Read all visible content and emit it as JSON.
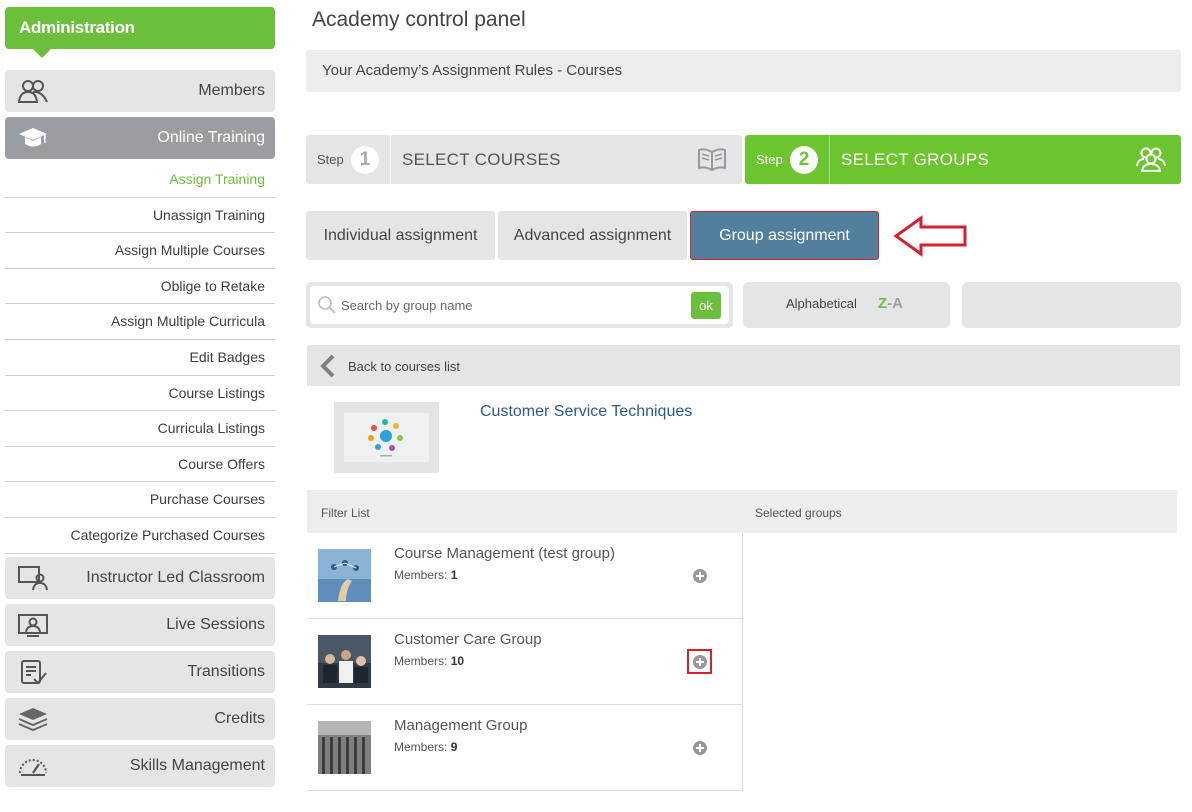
{
  "sidebar": {
    "header": "Administration",
    "items": [
      {
        "label": "Members",
        "icon": "members-icon"
      },
      {
        "label": "Online Training",
        "icon": "graduation-cap-icon",
        "active": true
      },
      {
        "label": "Instructor Led Classroom",
        "icon": "classroom-icon"
      },
      {
        "label": "Live Sessions",
        "icon": "live-session-icon"
      },
      {
        "label": "Transitions",
        "icon": "transitions-icon"
      },
      {
        "label": "Credits",
        "icon": "credits-stack-icon"
      },
      {
        "label": "Skills Management",
        "icon": "gauge-icon"
      }
    ],
    "subitems": [
      {
        "label": "Assign Training",
        "active": true
      },
      {
        "label": "Unassign Training"
      },
      {
        "label": "Assign Multiple Courses"
      },
      {
        "label": "Oblige to Retake"
      },
      {
        "label": "Assign Multiple Curricula"
      },
      {
        "label": "Edit Badges"
      },
      {
        "label": "Course Listings"
      },
      {
        "label": "Curricula Listings"
      },
      {
        "label": "Course Offers"
      },
      {
        "label": "Purchase Courses"
      },
      {
        "label": "Categorize Purchased Courses"
      }
    ]
  },
  "main": {
    "title": "Academy control panel",
    "rules_title": "Your Academy’s Assignment Rules - Courses",
    "steps": [
      {
        "label": "Step",
        "number": "1",
        "title": "SELECT COURSES",
        "icon": "open-book-icon"
      },
      {
        "label": "Step",
        "number": "2",
        "title": "SELECT GROUPS",
        "icon": "groups-icon",
        "active": true
      }
    ],
    "tabs": [
      {
        "label": "Individual assignment"
      },
      {
        "label": "Advanced assignment"
      },
      {
        "label": "Group assignment",
        "active": true
      }
    ],
    "search": {
      "placeholder": "Search by group name",
      "ok": "ok"
    },
    "sort": {
      "label": "Alphabetical",
      "z": "Z",
      "dash": "-",
      "a": "A"
    },
    "back": "Back to courses list",
    "course": {
      "title": "Customer Service Techniques"
    },
    "list": {
      "filter_header": "Filter List",
      "selected_header": "Selected groups",
      "members_label": "Members:",
      "groups": [
        {
          "name": "Course Management (test group)",
          "members": "1"
        },
        {
          "name": "Customer Care Group",
          "members": "10",
          "highlighted": true
        },
        {
          "name": "Management Group",
          "members": "9"
        }
      ]
    }
  },
  "colors": {
    "green": "#6cbf3c",
    "step_green": "#6cc42f",
    "active_tab": "#527f9b",
    "highlight_red": "#d52030",
    "link_blue": "#2c5b8a"
  }
}
